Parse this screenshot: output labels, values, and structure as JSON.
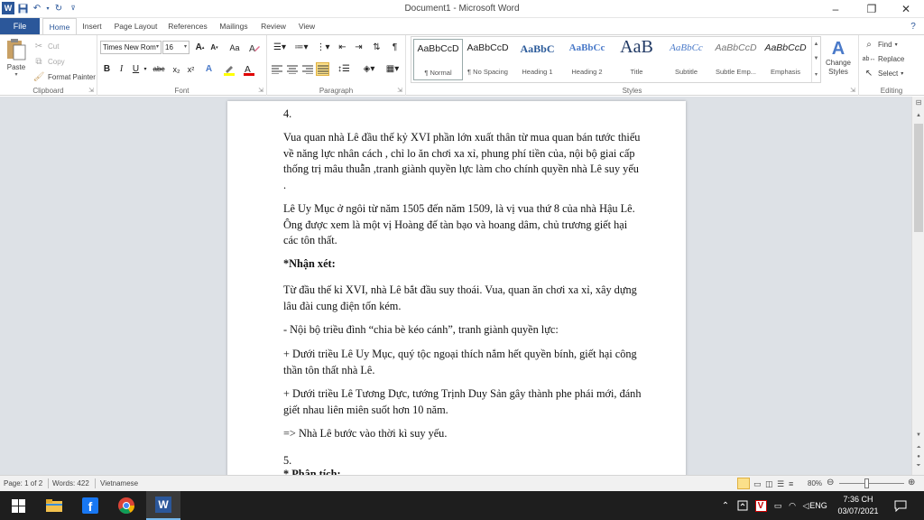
{
  "window": {
    "title": "Document1 - Microsoft Word",
    "app_icon": "W",
    "minimize": "–",
    "restore": "❐",
    "close": "✕"
  },
  "qat": {
    "save_icon": "save-icon",
    "undo_icon": "undo-icon",
    "redo_icon": "redo-icon"
  },
  "tabs": [
    "File",
    "Home",
    "Insert",
    "Page Layout",
    "References",
    "Mailings",
    "Review",
    "View"
  ],
  "active_tab": "Home",
  "ribbon": {
    "clipboard": {
      "label": "Clipboard",
      "paste": "Paste",
      "cut": "Cut",
      "copy": "Copy",
      "format_painter": "Format Painter"
    },
    "font": {
      "label": "Font",
      "font_name": "Times New Rom",
      "font_size": "16",
      "grow": "A",
      "shrink": "A",
      "change_case": "Aa",
      "bold": "B",
      "italic": "I",
      "underline": "U",
      "strike": "abc",
      "subscript": "x₂",
      "superscript": "x²"
    },
    "paragraph": {
      "label": "Paragraph",
      "pilcrow": "¶"
    },
    "styles": {
      "label": "Styles",
      "items": [
        {
          "preview": "AaBbCcD",
          "name": "¶ Normal"
        },
        {
          "preview": "AaBbCcD",
          "name": "¶ No Spacing"
        },
        {
          "preview": "AaBbC",
          "name": "Heading 1"
        },
        {
          "preview": "AaBbCc",
          "name": "Heading 2"
        },
        {
          "preview": "AaB",
          "name": "Title"
        },
        {
          "preview": "AaBbCc",
          "name": "Subtitle"
        },
        {
          "preview": "AaBbCcD",
          "name": "Subtle Emp..."
        },
        {
          "preview": "AaBbCcD",
          "name": "Emphasis"
        }
      ],
      "change_styles": "Change Styles"
    },
    "editing": {
      "label": "Editing",
      "find": "Find",
      "replace": "Replace",
      "select": "Select"
    }
  },
  "document": {
    "paragraphs": [
      "4.",
      "Vua quan nhà Lê đầu thế kỷ XVI phần lớn xuất thân từ mua quan bán tước thiếu về năng lực nhân cách , chỉ lo ăn chơi xa xỉ, phung phí tiền của, nội bộ giai cấp thống trị mâu thuẫn ,tranh giành quyền lực làm cho chính quyền nhà Lê suy yếu .",
      "Lê Uy Mục ở ngôi từ năm 1505 đến năm 1509, là vị vua thứ 8 của nhà Hậu Lê. Ông được xem là một vị Hoàng đế tàn bạo và hoang dâm, chủ trương giết hại các tôn thất.",
      "*Nhận xét:",
      "Từ đầu thế kỉ XVI, nhà Lê bắt đầu suy thoái. Vua, quan ăn chơi xa xỉ, xây dựng lâu đài cung điện tốn kém.",
      "- Nội bộ triều đình “chia bè kéo cánh”, tranh giành quyền lực:",
      "+ Dưới triều Lê Uy Mục, quý tộc ngoại thích nắm hết quyền bính, giết hại công thần tôn thất nhà Lê.",
      "+ Dưới triều Lê Tương Dực, tướng Trịnh Duy Sản gây thành phe phái mới, đánh giết nhau liên miên suốt hơn 10 năm.",
      "=> Nhà Lê bước vào thời kì suy yếu.",
      "5.",
      "* Phân tích:"
    ]
  },
  "status": {
    "page": "Page: 1 of 2",
    "words": "Words: 422",
    "language": "Vietnamese",
    "zoom": "80%"
  },
  "taskbar": {
    "lang": "ENG",
    "time": "7:36 CH",
    "date": "03/07/2021"
  }
}
